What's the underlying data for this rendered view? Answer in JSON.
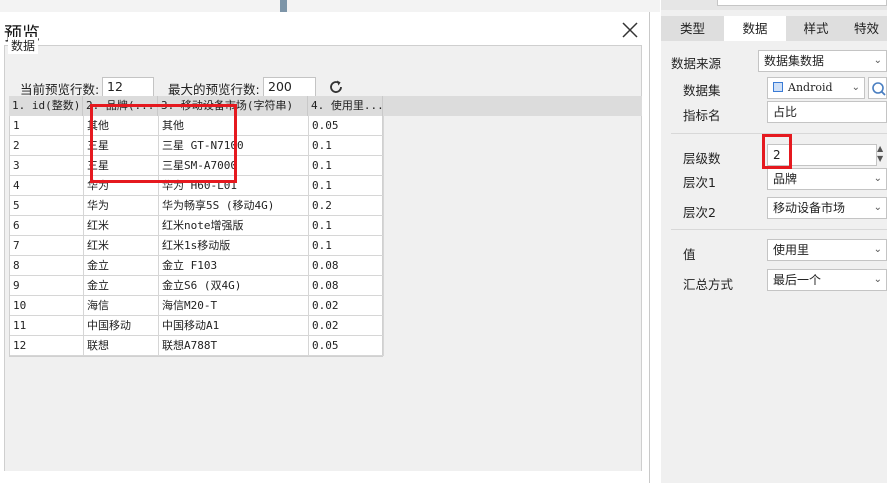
{
  "dialog": {
    "title": "预览",
    "group_label": "数据",
    "preview_rows_label": "当前预览行数:",
    "preview_rows_value": "12",
    "max_rows_label": "最大的预览行数:",
    "max_rows_value": "200"
  },
  "table": {
    "headers": [
      "1. id(整数)",
      "2. 品牌(...",
      "3. 移动设备市场(字符串)",
      "4. 使用里..."
    ],
    "rows": [
      [
        "1",
        "其他",
        "其他",
        "0.05"
      ],
      [
        "2",
        "三星",
        "三星 GT-N7100",
        "0.1"
      ],
      [
        "3",
        "三星",
        "三星SM-A7000",
        "0.1"
      ],
      [
        "4",
        "华为",
        "华为 H60-L01",
        "0.1"
      ],
      [
        "5",
        "华为",
        "华为畅享5S (移动4G)",
        "0.2"
      ],
      [
        "6",
        "红米",
        "红米note增强版",
        "0.1"
      ],
      [
        "7",
        "红米",
        "红米1s移动版",
        "0.1"
      ],
      [
        "8",
        "金立",
        "金立 F103",
        "0.08"
      ],
      [
        "9",
        "金立",
        "金立S6 (双4G)",
        "0.08"
      ],
      [
        "10",
        "海信",
        "海信M20-T",
        "0.02"
      ],
      [
        "11",
        "中国移动",
        "中国移动A1",
        "0.02"
      ],
      [
        "12",
        "联想",
        "联想A788T",
        "0.05"
      ]
    ]
  },
  "panel": {
    "tabs": [
      "类型",
      "数据",
      "样式",
      "特效"
    ],
    "active_tab": "数据",
    "data_source_label": "数据来源",
    "data_source_value": "数据集数据",
    "dataset_label": "数据集",
    "dataset_value": "Android",
    "indicator_label": "指标名",
    "indicator_value": "占比",
    "levels_label": "层级数",
    "levels_value": "2",
    "level1_label": "层次1",
    "level1_value": "品牌",
    "level2_label": "层次2",
    "level2_value": "移动设备市场",
    "value_label": "值",
    "value_value": "使用里",
    "summary_label": "汇总方式",
    "summary_value": "最后一个"
  },
  "colors": {
    "annotation_red": "#e5191f",
    "tab_active": "#ffffff",
    "header_gray": "#dcdcdc"
  },
  "icons": [
    "close-icon",
    "refresh-icon",
    "dataset-icon",
    "search-icon",
    "chevron-down-icon",
    "spinner-arrows-icon"
  ]
}
